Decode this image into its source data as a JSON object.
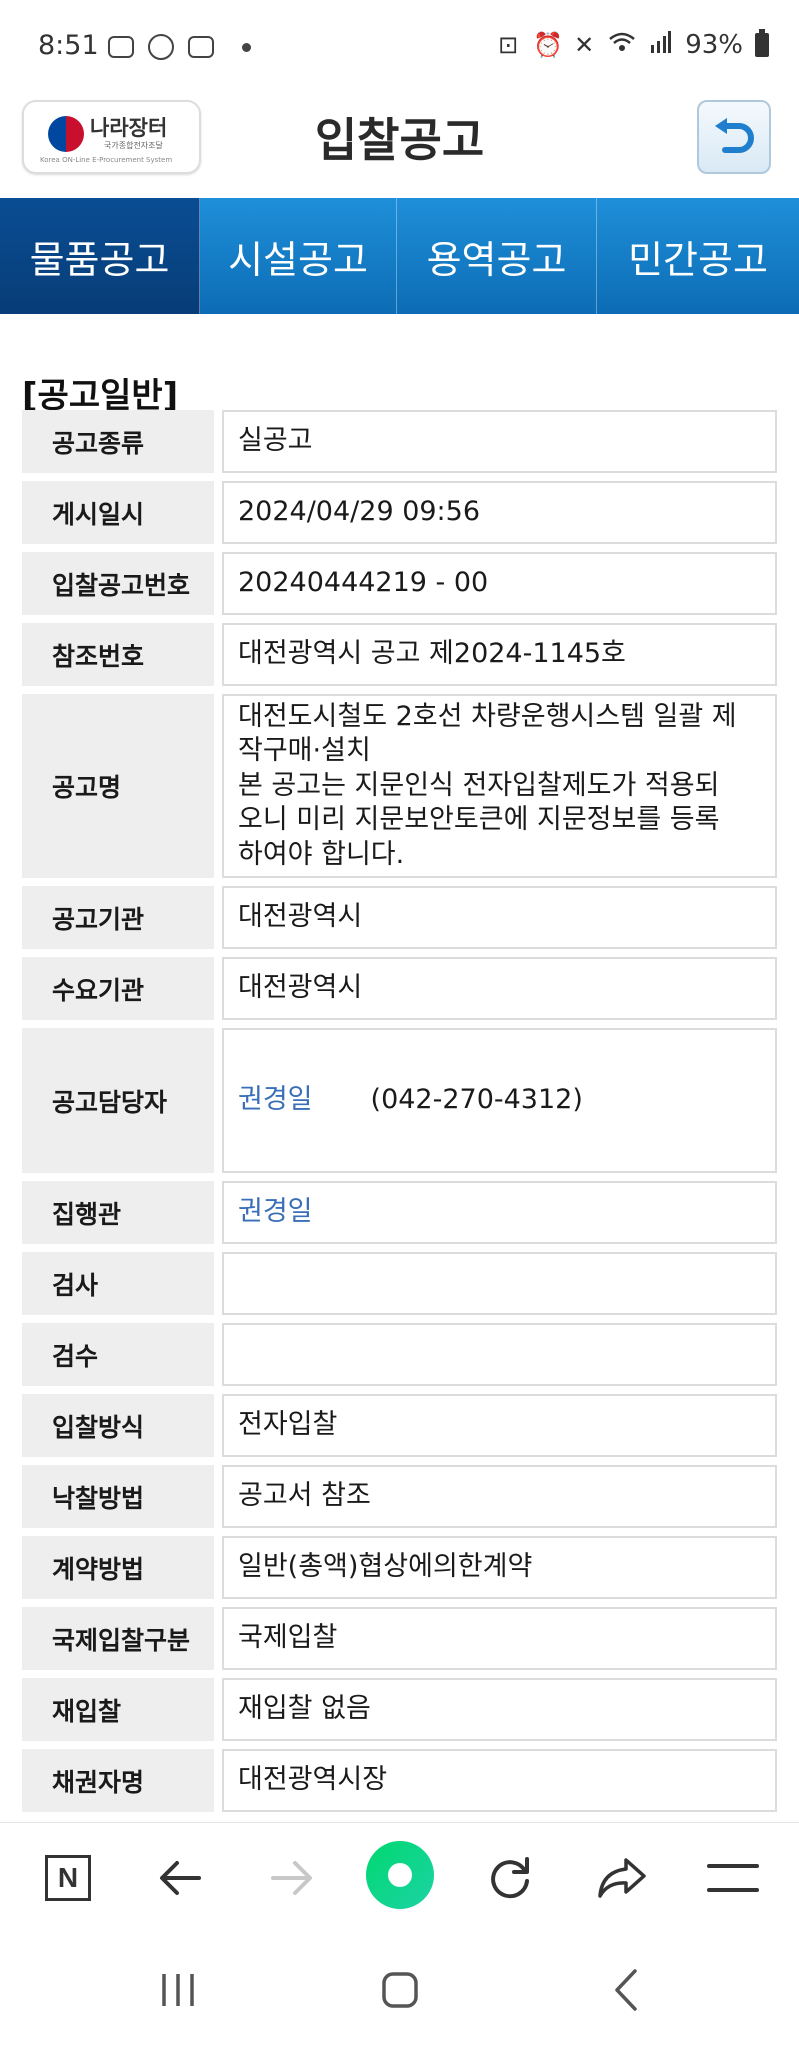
{
  "status_bar": {
    "time": "8:51",
    "battery": "93%",
    "left_icons": [
      "video-icon",
      "b-icon",
      "blog-icon"
    ],
    "right_icons": [
      "lock-icon",
      "alarm-icon",
      "mute-icon",
      "wifi-icon",
      "signal-icon",
      "battery-icon"
    ]
  },
  "header": {
    "logo_text": "나라장터",
    "logo_sub1": "국가종합전자조달",
    "logo_sub2": "Korea ON-Line E-Procurement System",
    "title": "입찰공고"
  },
  "tabs": [
    {
      "label": "물품공고",
      "active": true
    },
    {
      "label": "시설공고",
      "active": false
    },
    {
      "label": "용역공고",
      "active": false
    },
    {
      "label": "민간공고",
      "active": false
    }
  ],
  "section": {
    "title": "[공고일반]",
    "rows": [
      {
        "label": "공고종류",
        "value": "실공고"
      },
      {
        "label": "게시일시",
        "value": "2024/04/29 09:56"
      },
      {
        "label": "입찰공고번호",
        "value": "20240444219 - 00"
      },
      {
        "label": "참조번호",
        "value": "대전광역시 공고 제2024-1145호"
      },
      {
        "label": "공고명",
        "lines": [
          "대전도시철도 2호선 차량운행시스템 일괄 제",
          "작구매·설치",
          "본 공고는 지문인식 전자입찰제도가 적용되",
          "오니 미리 지문보안토큰에 지문정보를 등록",
          "하여야 합니다."
        ]
      },
      {
        "label": "공고기관",
        "value": "대전광역시"
      },
      {
        "label": "수요기관",
        "value": "대전광역시"
      },
      {
        "label": "공고담당자",
        "value": "권경일",
        "phone": "(042-270-4312)"
      },
      {
        "label": "집행관",
        "value": "권경일"
      },
      {
        "label": "검사",
        "value": ""
      },
      {
        "label": "검수",
        "value": ""
      },
      {
        "label": "입찰방식",
        "value": "전자입찰"
      },
      {
        "label": "낙찰방법",
        "value": "공고서 참조"
      },
      {
        "label": "계약방법",
        "value": "일반(총액)협상에의한계약"
      },
      {
        "label": "국제입찰구분",
        "value": "국제입찰"
      },
      {
        "label": "재입찰",
        "value": "재입찰 없음"
      },
      {
        "label": "채권자명",
        "value": "대전광역시장"
      }
    ]
  },
  "browser_bar": {
    "n_label": "N"
  }
}
